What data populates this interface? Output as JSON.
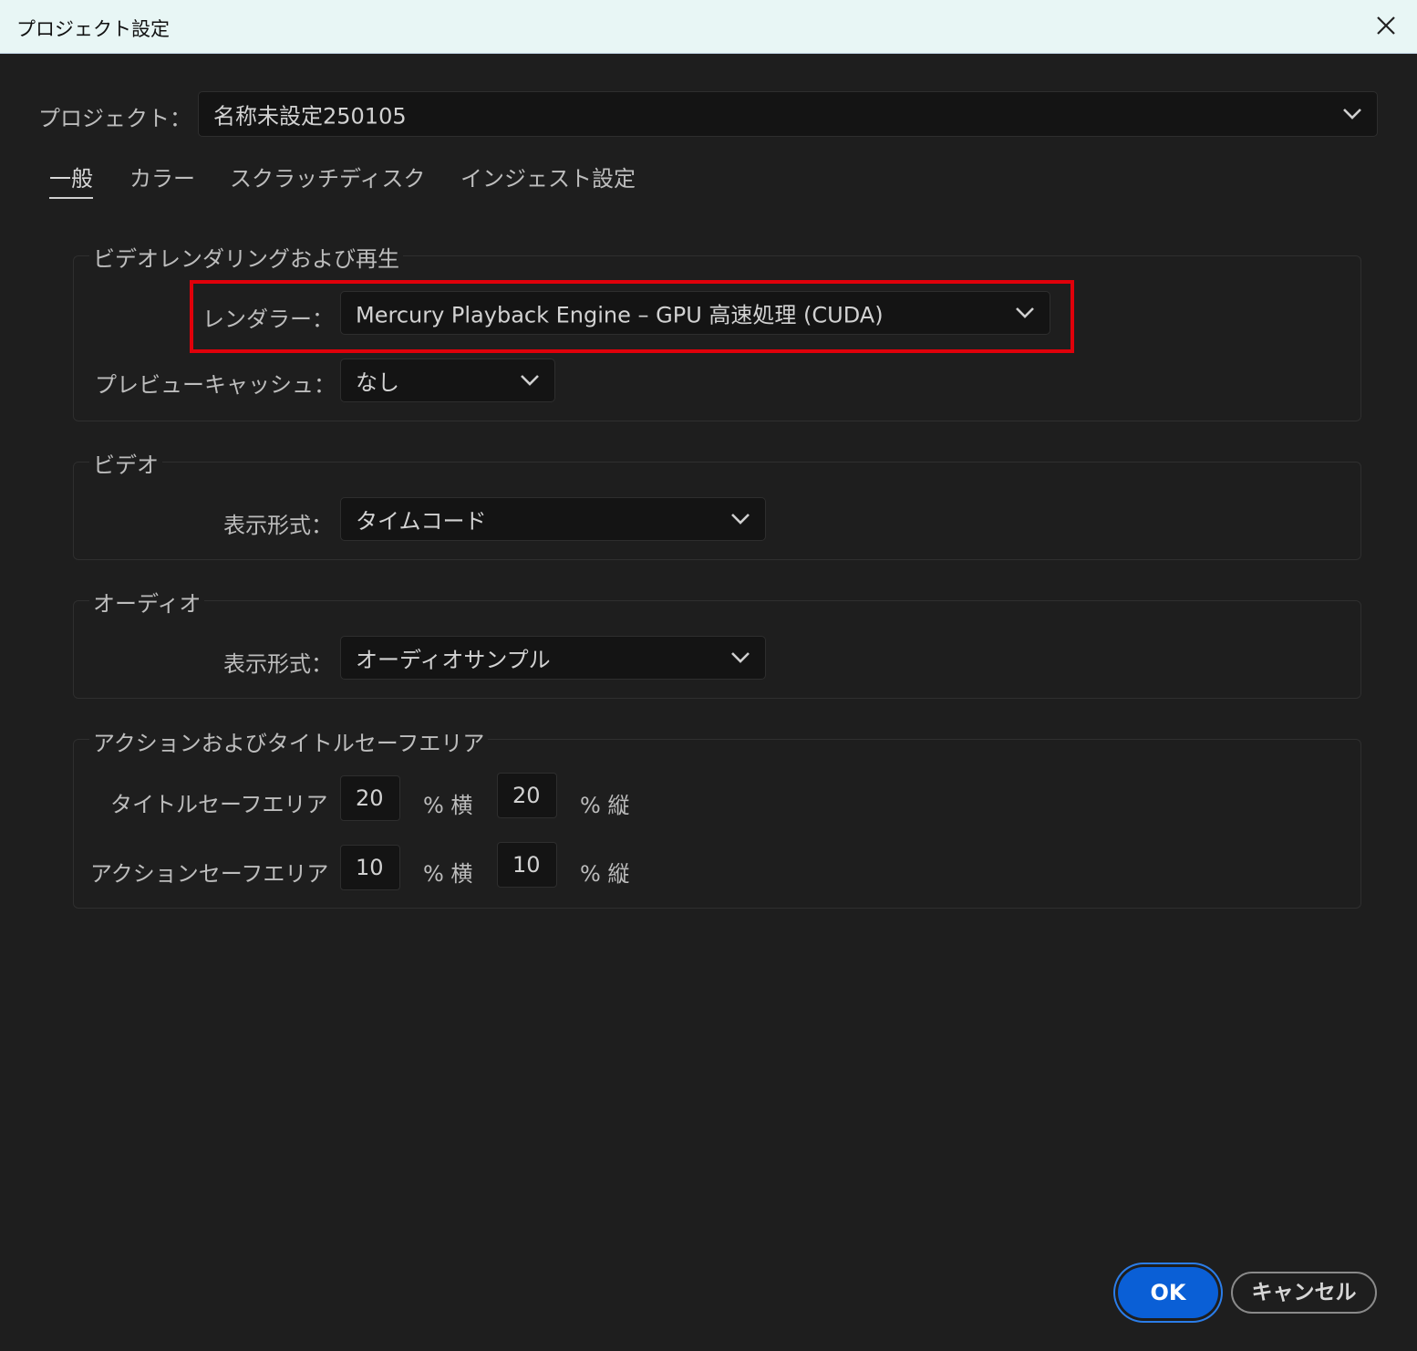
{
  "window": {
    "title": "プロジェクト設定"
  },
  "project": {
    "label": "プロジェクト：",
    "value": "名称未設定250105"
  },
  "tabs": [
    {
      "label": "一般",
      "active": true
    },
    {
      "label": "カラー"
    },
    {
      "label": "スクラッチディスク"
    },
    {
      "label": "インジェスト設定"
    }
  ],
  "render_group": {
    "title": "ビデオレンダリングおよび再生",
    "renderer_label": "レンダラー：",
    "renderer_value": "Mercury Playback Engine – GPU 高速処理 (CUDA)",
    "preview_cache_label": "プレビューキャッシュ：",
    "preview_cache_value": "なし"
  },
  "video_group": {
    "title": "ビデオ",
    "format_label": "表示形式：",
    "format_value": "タイムコード"
  },
  "audio_group": {
    "title": "オーディオ",
    "format_label": "表示形式：",
    "format_value": "オーディオサンプル"
  },
  "safe_group": {
    "title": "アクションおよびタイトルセーフエリア",
    "title_safe_label": "タイトルセーフエリア",
    "title_safe_h": "20",
    "title_safe_v": "20",
    "action_safe_label": "アクションセーフエリア",
    "action_safe_h": "10",
    "action_safe_v": "10",
    "unit_h": "% 横",
    "unit_v": "% 縦"
  },
  "buttons": {
    "ok": "OK",
    "cancel": "キャンセル"
  },
  "colors": {
    "accent": "#0a5fd6",
    "highlight": "#e0000a"
  },
  "icons": [
    "close-icon",
    "chevron-down-icon"
  ]
}
